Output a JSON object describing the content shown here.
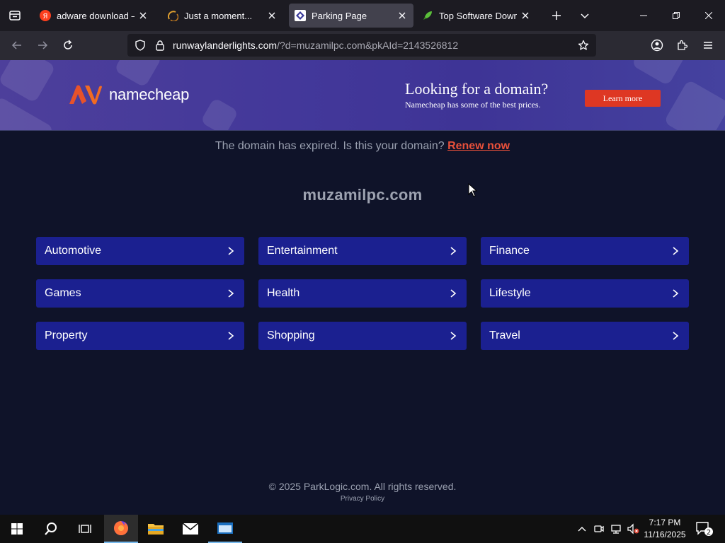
{
  "browser": {
    "tabs": [
      {
        "title": "adware download — Ян",
        "favicon": "yandex-icon",
        "active": false
      },
      {
        "title": "Just a moment...",
        "favicon": "loading-icon",
        "active": false
      },
      {
        "title": "Parking Page",
        "favicon": "parking-page-icon",
        "active": true
      },
      {
        "title": "Top Software Downloads",
        "favicon": "rocket-icon",
        "active": false
      }
    ],
    "url": {
      "host": "runwaylanderlights.com",
      "path": "/?d=muzamilpc.com&pkAId=2143526812"
    }
  },
  "banner": {
    "logo_text": "namecheap",
    "headline": "Looking for a domain?",
    "subtext": "Namecheap has some of the best prices.",
    "button_label": "Learn more",
    "accent_color": "#de3723"
  },
  "page": {
    "expired_text": "The domain has expired. Is this your domain?",
    "renew_link": "Renew now",
    "domain": "muzamilpc.com",
    "categories": [
      "Automotive",
      "Entertainment",
      "Finance",
      "Games",
      "Health",
      "Lifestyle",
      "Property",
      "Shopping",
      "Travel"
    ],
    "copyright": "© 2025 ParkLogic.com. All rights reserved.",
    "privacy_link": "Privacy Policy"
  },
  "taskbar": {
    "time": "7:17 PM",
    "date": "11/16/2025",
    "notification_count": "2"
  }
}
